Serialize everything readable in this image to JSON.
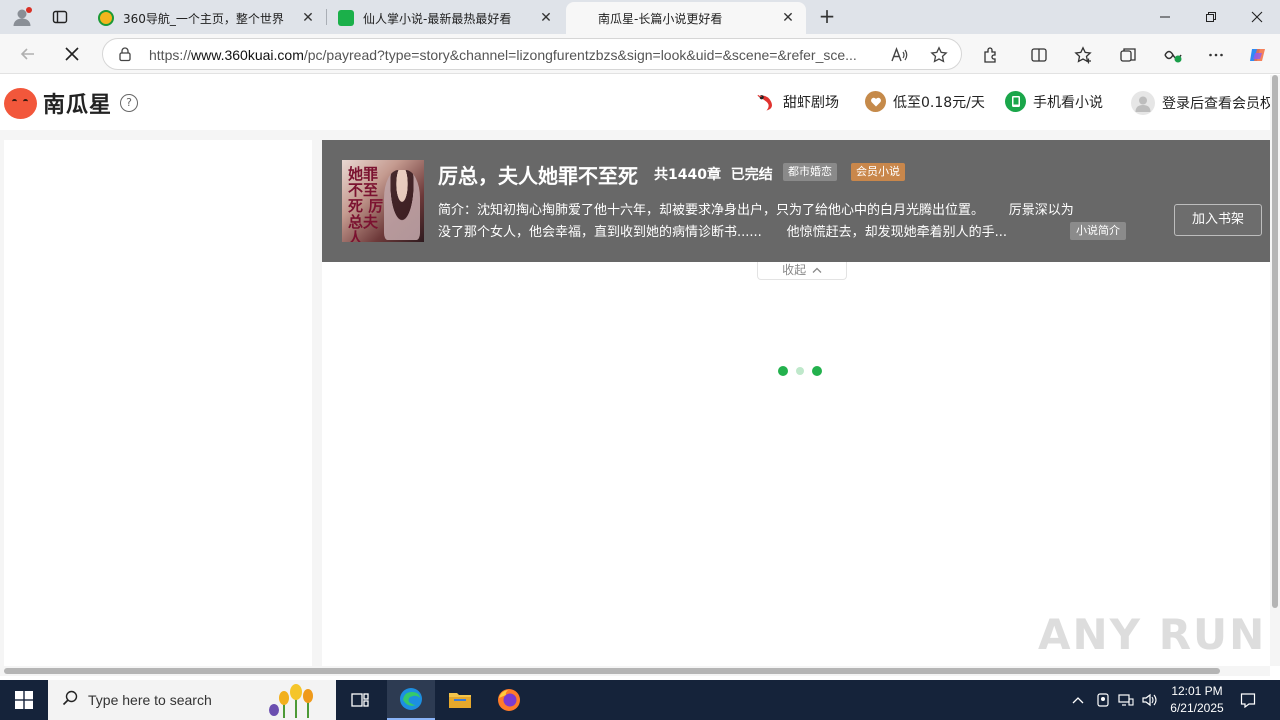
{
  "browser": {
    "tabs": [
      {
        "title": "360导航_一个主页，整个世界",
        "favicon_color": "#f3b51d",
        "active": false
      },
      {
        "title": "仙人掌小说-最新最热最好看",
        "favicon_color": "#1bb04a",
        "active": false
      },
      {
        "title": "南瓜星-长篇小说更好看",
        "favicon_color": "",
        "active": true
      }
    ],
    "close_glyph": "✕",
    "new_tab_glyph": "+",
    "url_prefix": "https://",
    "url_host": "www.360kuai.com",
    "url_path": "/pc/payread?type=story&channel=lizongfurentzbzs&sign=look&uid=&scene=&refer_sce..."
  },
  "site": {
    "logo_text": "南瓜星",
    "help_glyph": "?",
    "header_links": [
      {
        "label": "甜虾剧场",
        "icon": "shrimp-icon"
      },
      {
        "label": "低至0.18元/天",
        "icon": "heart-badge-icon"
      },
      {
        "label": "手机看小说",
        "icon": "phone-icon"
      },
      {
        "label": "登录后查看会员权",
        "icon": "user-avatar-icon"
      }
    ]
  },
  "book": {
    "cover_text": "她罪不至死 厉总夫人",
    "title": "厉总，夫人她罪不至死",
    "chapters": "共1440章",
    "status": "已完结",
    "genre_tag": "都市婚恋",
    "vip_tag": "会员小说",
    "synopsis_line1": "简介：沈知初掏心掏肺爱了他十六年，却被要求净身出户，只为了给他心中的白月光腾出位置。      厉景深以为",
    "synopsis_line2": "没了那个女人，他会幸福，直到收到她的病情诊断书......      他惊慌赶去，却发现她牵着别人的手...",
    "synopsis_button": "小说简介",
    "add_shelf_button": "加入书架",
    "collapse_label": "收起"
  },
  "watermark": "ANY RUN",
  "taskbar": {
    "search_placeholder": "Type here to search",
    "time": "12:01 PM",
    "date": "6/21/2025"
  },
  "colors": {
    "banner_bg": "#686868",
    "loader_green": "#23b14d",
    "vip_tag": "#c9874b",
    "logo_red": "#f2573b"
  }
}
